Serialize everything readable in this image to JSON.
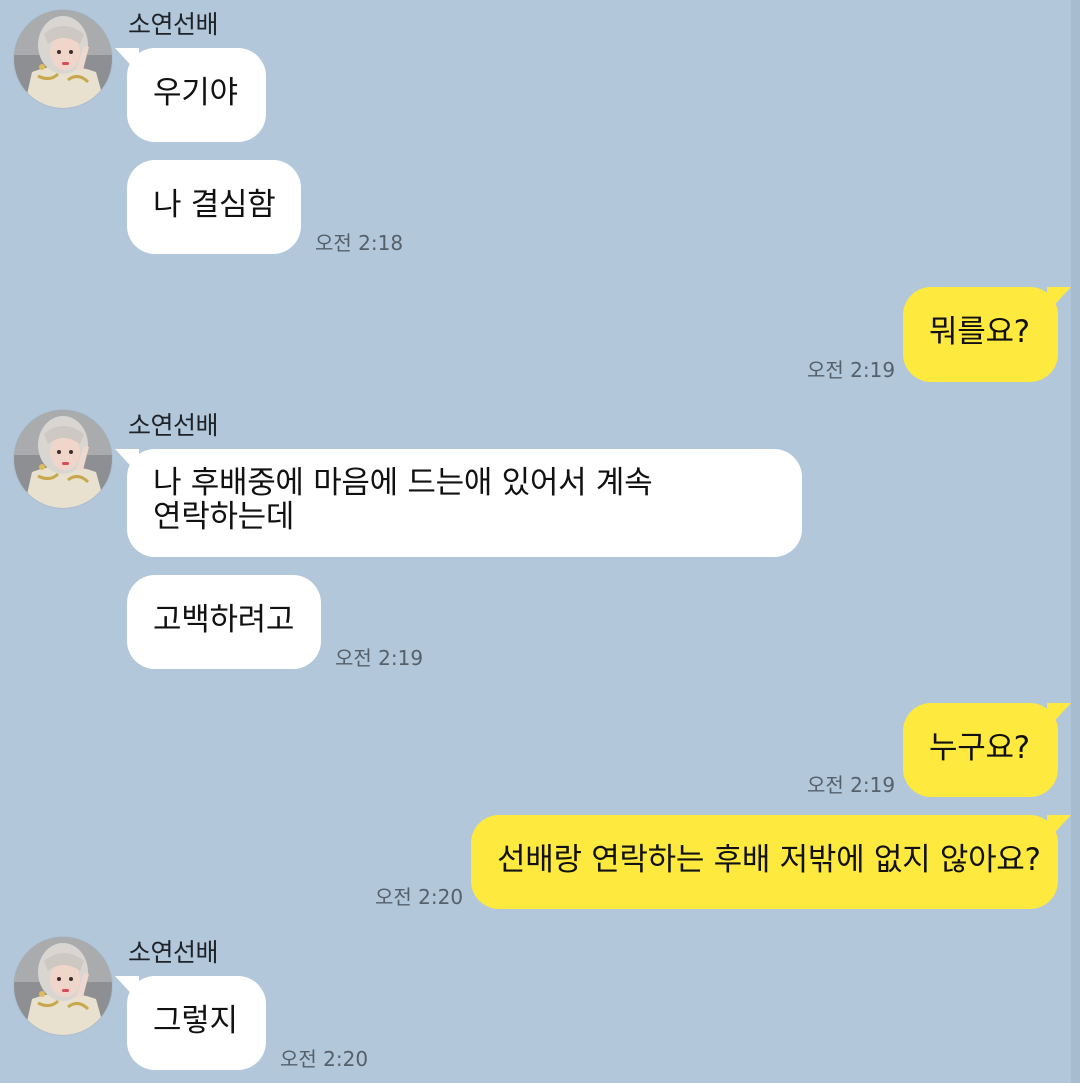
{
  "chat": {
    "colors": {
      "background": "#b2c7da",
      "incoming_bubble": "#ffffff",
      "outgoing_bubble": "#fee93e"
    },
    "groups": [
      {
        "sender": "소연선배",
        "messages": [
          "우기야",
          "나 결심함"
        ],
        "time": "오전 2:18"
      },
      {
        "sender": "me",
        "messages": [
          "뭐를요?"
        ],
        "time": "오전 2:19"
      },
      {
        "sender": "소연선배",
        "messages": [
          "나 후배중에 마음에 드는애 있어서 계속 연락하는데",
          "고백하려고"
        ],
        "time": "오전 2:19"
      },
      {
        "sender": "me",
        "messages": [
          "누구요?"
        ],
        "time": "오전 2:19"
      },
      {
        "sender": "me",
        "messages": [
          "선배랑 연락하는 후배 저밖에 없지 않아요?"
        ],
        "time": "오전 2:20"
      },
      {
        "sender": "소연선배",
        "messages": [
          "그렇지"
        ],
        "time": "오전 2:20"
      }
    ]
  }
}
